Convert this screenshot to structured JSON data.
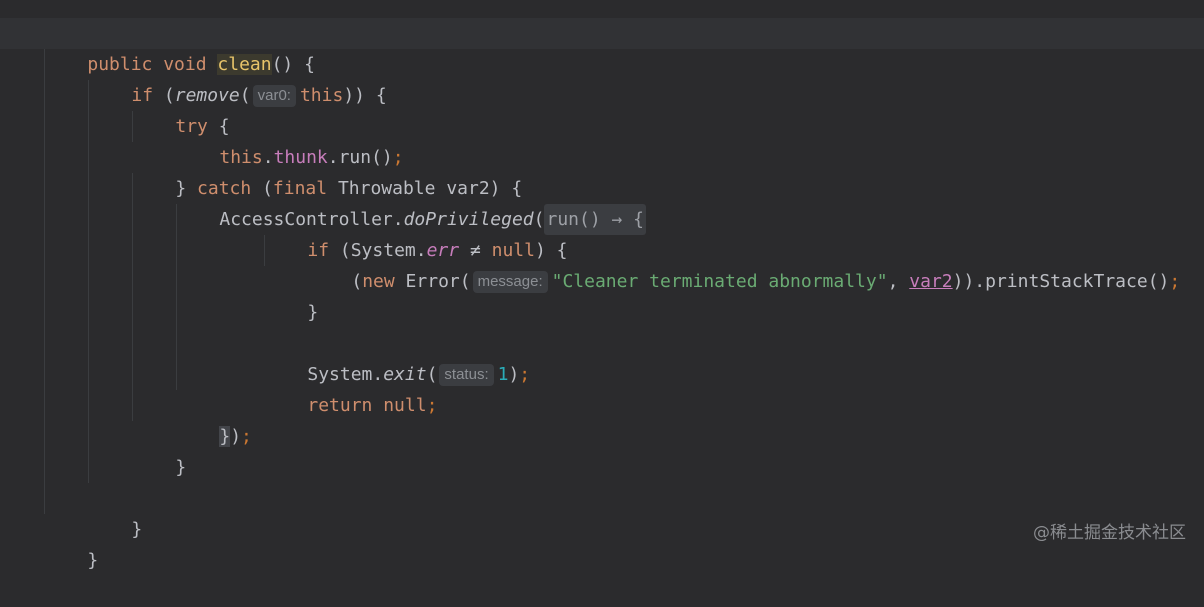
{
  "code": {
    "l1": {
      "kw": "public void ",
      "fn": "clean",
      "rest": "() {"
    },
    "l2": {
      "kw": "if",
      "p1": " (",
      "fn": "remove",
      "p2": "(",
      "hint": "var0:",
      "this": "this",
      "p3": ")) {"
    },
    "l3": {
      "kw": "try",
      "rest": " {"
    },
    "l4": {
      "this": "this",
      "dot1": ".",
      "field": "thunk",
      "rest": ".run()",
      "semi": ";"
    },
    "l5": {
      "p1": "} ",
      "kw1": "catch",
      "p2": " (",
      "kw2": "final",
      "rest": " Throwable var2) {"
    },
    "l6": {
      "cls": "AccessController.",
      "fn": "doPrivileged",
      "p1": "(",
      "fold": "run() → {"
    },
    "l7": {
      "kw": "if",
      "p1": " (System.",
      "field": "err",
      "op": " ≠ ",
      "kw2": "null",
      "p2": ") {"
    },
    "l8": {
      "p1": "(",
      "kw": "new",
      "p2": " Error(",
      "hint": "message:",
      "str": "\"Cleaner terminated abnormally\"",
      "p3": ", ",
      "var": "var2",
      "p4": ")).printStackTrace()",
      "semi": ";"
    },
    "l9": {
      "rest": "}"
    },
    "l10": {
      "p1": "System.",
      "fn": "exit",
      "p2": "(",
      "hint": "status:",
      "num": "1",
      "p3": ")",
      "semi": ";"
    },
    "l11": {
      "kw": "return null",
      "semi": ";"
    },
    "l12": {
      "brace": "}",
      "p1": ")",
      "semi": ";"
    },
    "l13": {
      "rest": "}"
    },
    "l14": {
      "rest": "}"
    },
    "l15": {
      "rest": "}"
    }
  },
  "watermark": "@稀土掘金技术社区"
}
